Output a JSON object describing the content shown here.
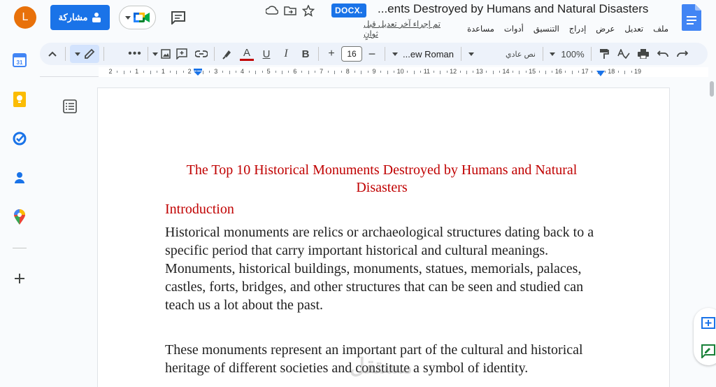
{
  "header": {
    "avatar_initial": "L",
    "share_label": "مشاركة",
    "docx_badge": "DOCX.",
    "title": "...ents Destroyed by Humans and Natural Disasters",
    "last_edit": "تم إجراء آخر تعديل قبل ثوانٍ",
    "menu": [
      "ملف",
      "تعديل",
      "عرض",
      "إدراج",
      "التنسيق",
      "أدوات",
      "مساعدة"
    ]
  },
  "toolbar": {
    "font_size": "16",
    "font_name": "...ew Roman",
    "style_name": "نص عادي",
    "zoom": "100%",
    "text_color": "#c00000"
  },
  "ruler": {
    "numbers": [
      "2",
      "1",
      "1",
      "2",
      "3",
      "4",
      "5",
      "6",
      "7",
      "8",
      "9",
      "10",
      "11",
      "12",
      "13",
      "14",
      "15",
      "16",
      "17",
      "18",
      "19"
    ]
  },
  "document": {
    "heading": "The Top 10 Historical Monuments Destroyed by Humans and Natural Disasters",
    "subheading": "Introduction",
    "paragraph1": "Historical monuments are relics or archaeological structures dating back to a specific period that carry important historical and cultural meanings. Monuments, historical buildings, monuments, statues, memorials, palaces, castles, forts, bridges, and other structures that can be seen and studied can teach us a lot about the past.",
    "paragraph2": "These monuments represent an important part of the cultural and historical heritage of different societies and constitute a symbol of identity.",
    "heading_color": "#c00000"
  },
  "watermark": "مستقل",
  "colors": {
    "accent": "#1a73e8",
    "avatar": "#e8710a",
    "toolbar_bg": "#edf2fa"
  }
}
